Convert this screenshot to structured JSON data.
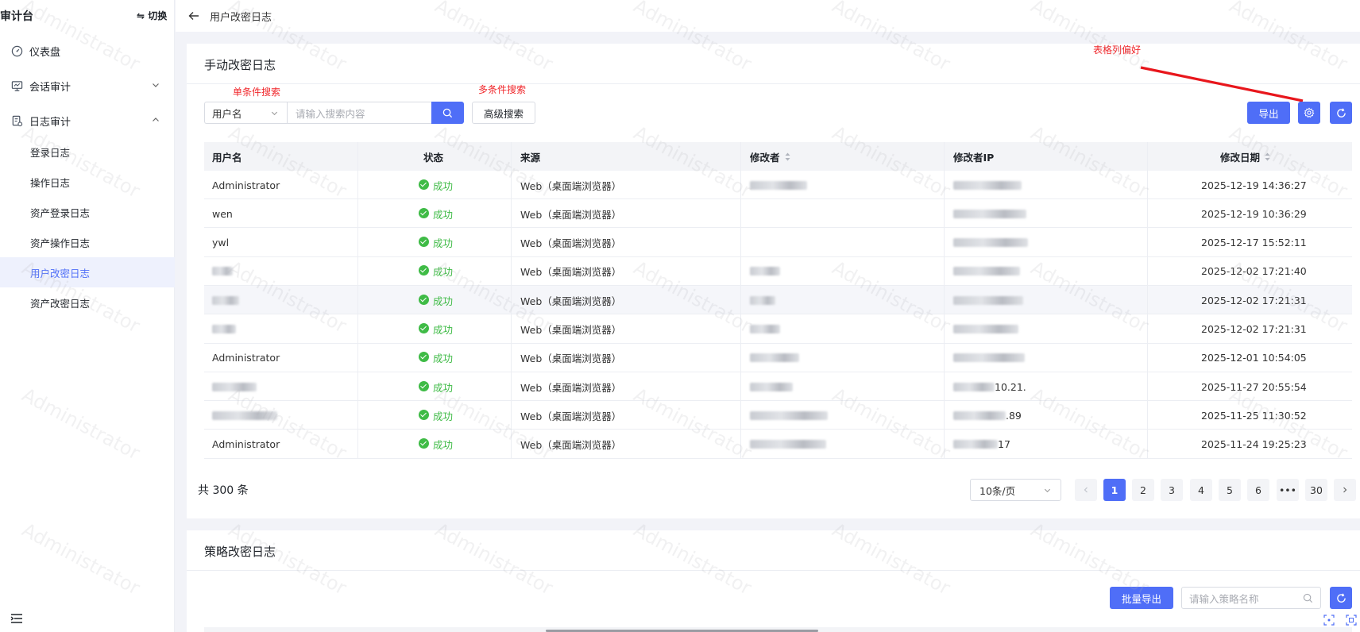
{
  "sidebar": {
    "title": "审计台",
    "switch_label": "⇋ 切换",
    "menu": [
      {
        "label": "仪表盘"
      },
      {
        "label": "会话审计"
      },
      {
        "label": "日志审计"
      }
    ],
    "sub_items": [
      {
        "label": "登录日志"
      },
      {
        "label": "操作日志"
      },
      {
        "label": "资产登录日志"
      },
      {
        "label": "资产操作日志"
      },
      {
        "label": "用户改密日志",
        "active": true
      },
      {
        "label": "资产改密日志"
      }
    ]
  },
  "topbar": {
    "breadcrumb": "用户改密日志"
  },
  "manual": {
    "title": "手动改密日志",
    "annotations": {
      "single": "单条件搜索",
      "multi": "多条件搜索",
      "column_pref": "表格列偏好"
    },
    "filter": {
      "field_value": "用户名",
      "search_placeholder": "请输入搜索内容",
      "advanced_label": "高级搜索"
    },
    "export_label": "导出",
    "columns": [
      "用户名",
      "状态",
      "来源",
      "修改者",
      "修改者IP",
      "修改日期"
    ],
    "rows": [
      {
        "user": "Administrator",
        "status": "成功",
        "source": "Web（桌面端浏览器）",
        "modifier": "",
        "ip": "",
        "date": "2025-12-19 14:36:27"
      },
      {
        "user": "wen",
        "status": "成功",
        "source": "Web（桌面端浏览器）",
        "modifier": "",
        "ip": "",
        "date": "2025-12-19 10:36:29"
      },
      {
        "user": "ywl",
        "status": "成功",
        "source": "Web（桌面端浏览器）",
        "modifier": "",
        "ip": "",
        "date": "2025-12-17 15:52:11"
      },
      {
        "user": "",
        "status": "成功",
        "source": "Web（桌面端浏览器）",
        "modifier": "",
        "ip": "",
        "date": "2025-12-02 17:21:40"
      },
      {
        "user": "",
        "status": "成功",
        "source": "Web（桌面端浏览器）",
        "modifier": "",
        "ip": "",
        "date": "2025-12-02 17:21:31"
      },
      {
        "user": "",
        "status": "成功",
        "source": "Web（桌面端浏览器）",
        "modifier": "",
        "ip": "",
        "date": "2025-12-02 17:21:31"
      },
      {
        "user": "Administrator",
        "status": "成功",
        "source": "Web（桌面端浏览器）",
        "modifier": "",
        "ip": "",
        "date": "2025-12-01 10:54:05"
      },
      {
        "user": "",
        "status": "成功",
        "source": "Web（桌面端浏览器）",
        "modifier": "",
        "ip": "10.21.",
        "date": "2025-11-27 20:55:54"
      },
      {
        "user": "",
        "status": "成功",
        "source": "Web（桌面端浏览器）",
        "modifier": "",
        "ip": ".89",
        "date": "2025-11-25 11:30:52"
      },
      {
        "user": "Administrator",
        "status": "成功",
        "source": "Web（桌面端浏览器）",
        "modifier": "",
        "ip": "17",
        "date": "2025-11-24 19:25:23"
      }
    ],
    "total": "共 300 条",
    "page_size": "10条/页",
    "pages": [
      "1",
      "2",
      "3",
      "4",
      "5",
      "6",
      "•••",
      "30"
    ],
    "current_page": 1
  },
  "policy": {
    "title": "策略改密日志",
    "batch_export_label": "批量导出",
    "search_placeholder": "请输入策略名称"
  },
  "watermark": "Administrator",
  "colors": {
    "primary": "#4f6ef7",
    "success": "#3fbb46",
    "annotation": "#f0262a",
    "active_bg": "#eef1fd"
  }
}
